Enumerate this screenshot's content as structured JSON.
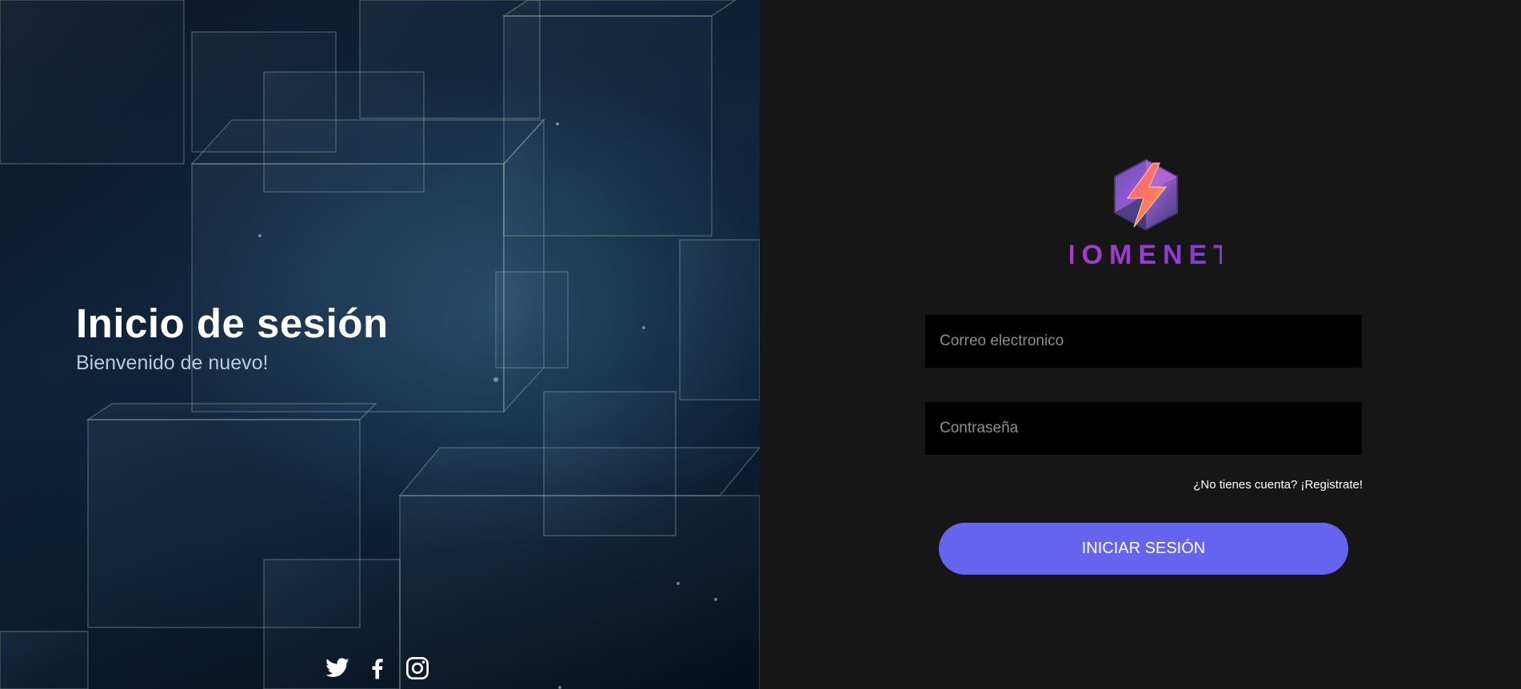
{
  "hero": {
    "title": "Inicio de sesión",
    "subtitle": "Bienvenido de nuevo!"
  },
  "social": {
    "icons": [
      "twitter-icon",
      "facebook-icon",
      "instagram-icon"
    ]
  },
  "brand": {
    "name": "HOMENET"
  },
  "form": {
    "email_placeholder": "Correo electronico",
    "password_placeholder": "Contraseña",
    "register_link": "¿No tienes cuenta? ¡Registrate!",
    "submit_label": "INICIAR SESIÓN"
  },
  "colors": {
    "panel_background": "#161616",
    "button": "#6464ee",
    "input_background": "#000000",
    "brand_gradient_start": "#b03cc6",
    "brand_gradient_end": "#7b3fd8"
  }
}
